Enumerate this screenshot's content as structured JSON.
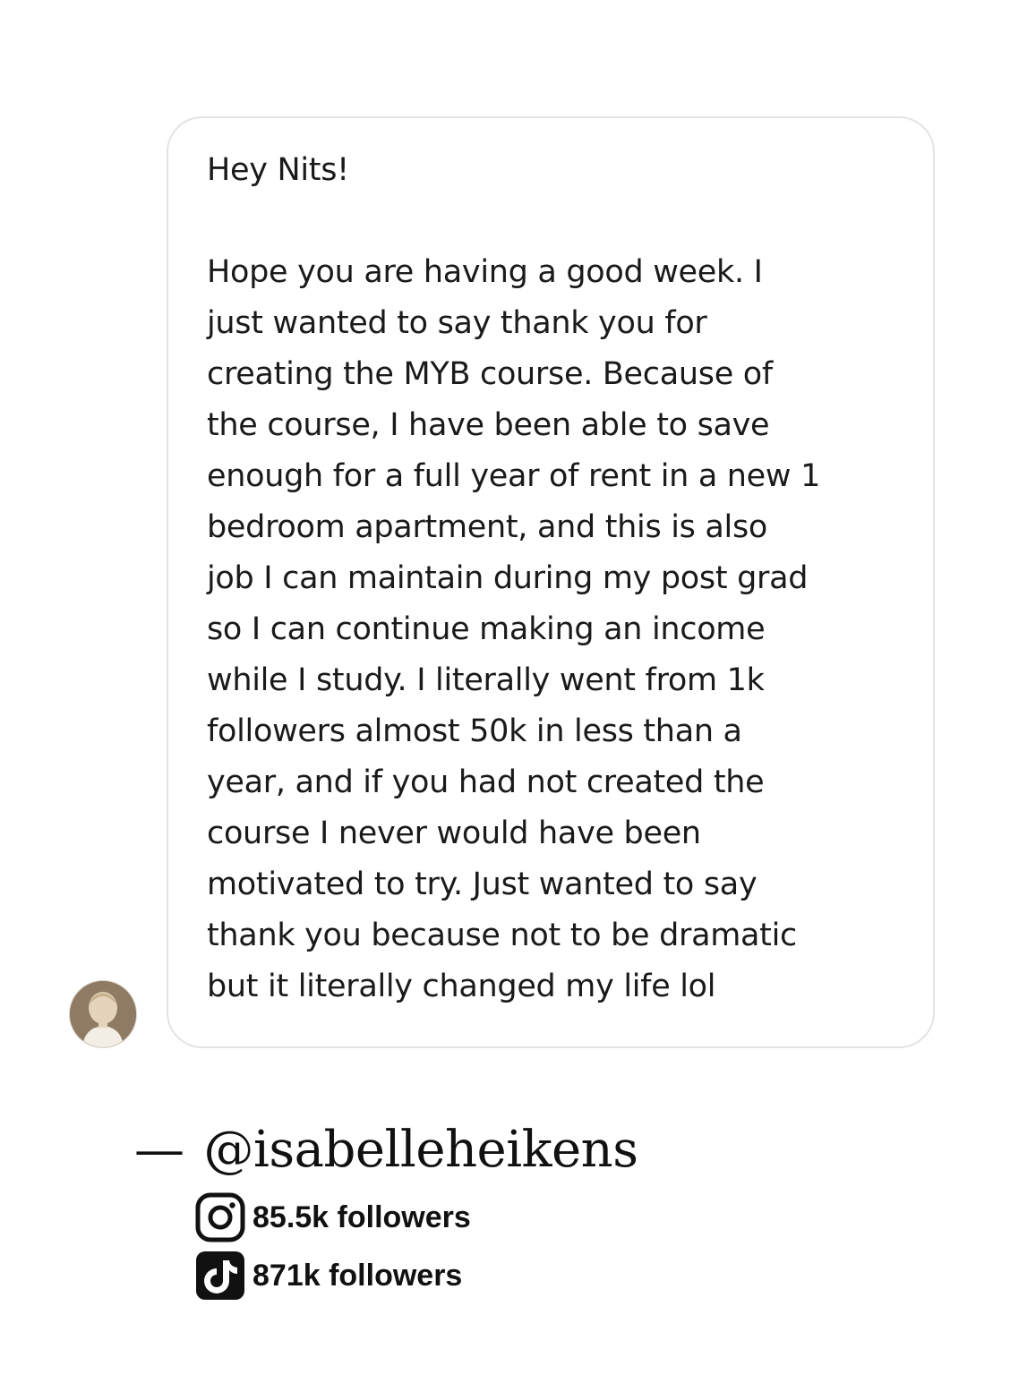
{
  "message": {
    "greeting": "Hey Nits!",
    "body_lines": [
      "Hope you are having a good week. I",
      "just wanted to say thank you for",
      "creating the MYB course. Because of",
      "the course, I have been able to save",
      "enough for a full year of rent in a new 1",
      "bedroom apartment, and this is also",
      "job I can maintain during my post grad",
      "so I can continue making an income",
      "while I study. I literally went from 1k",
      "followers almost 50k in less than a",
      "year, and if you had not created the",
      "course I never would have been",
      "motivated to try. Just wanted to say",
      "thank you because not to be dramatic",
      "but it literally changed my life lol"
    ]
  },
  "attribution": {
    "dash": "—",
    "handle": "@isabelleheikens"
  },
  "stats": {
    "instagram": {
      "icon": "instagram-icon",
      "label": "85.5k followers"
    },
    "tiktok": {
      "icon": "tiktok-icon",
      "label": "871k followers"
    }
  }
}
